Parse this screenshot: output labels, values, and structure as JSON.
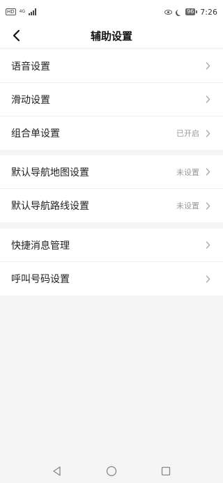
{
  "status_bar": {
    "left_badge": "HD",
    "network_top": "4G",
    "network_bottom": "",
    "battery": "96",
    "time": "7:26"
  },
  "header": {
    "title": "辅助设置",
    "back_icon": "chevron-left-icon"
  },
  "groups": [
    {
      "items": [
        {
          "label": "语音设置",
          "status": ""
        },
        {
          "label": "滑动设置",
          "status": ""
        },
        {
          "label": "组合单设置",
          "status": "已开启"
        }
      ]
    },
    {
      "items": [
        {
          "label": "默认导航地图设置",
          "status": "未设置"
        },
        {
          "label": "默认导航路线设置",
          "status": "未设置"
        }
      ]
    },
    {
      "items": [
        {
          "label": "快捷消息管理",
          "status": ""
        },
        {
          "label": "呼叫号码设置",
          "status": ""
        }
      ]
    }
  ],
  "nav_bar": {
    "back": "triangle-back-icon",
    "home": "circle-home-icon",
    "recents": "square-recents-icon"
  },
  "colors": {
    "background": "#f5f5f5",
    "card": "#ffffff",
    "status_text": "#999999"
  }
}
